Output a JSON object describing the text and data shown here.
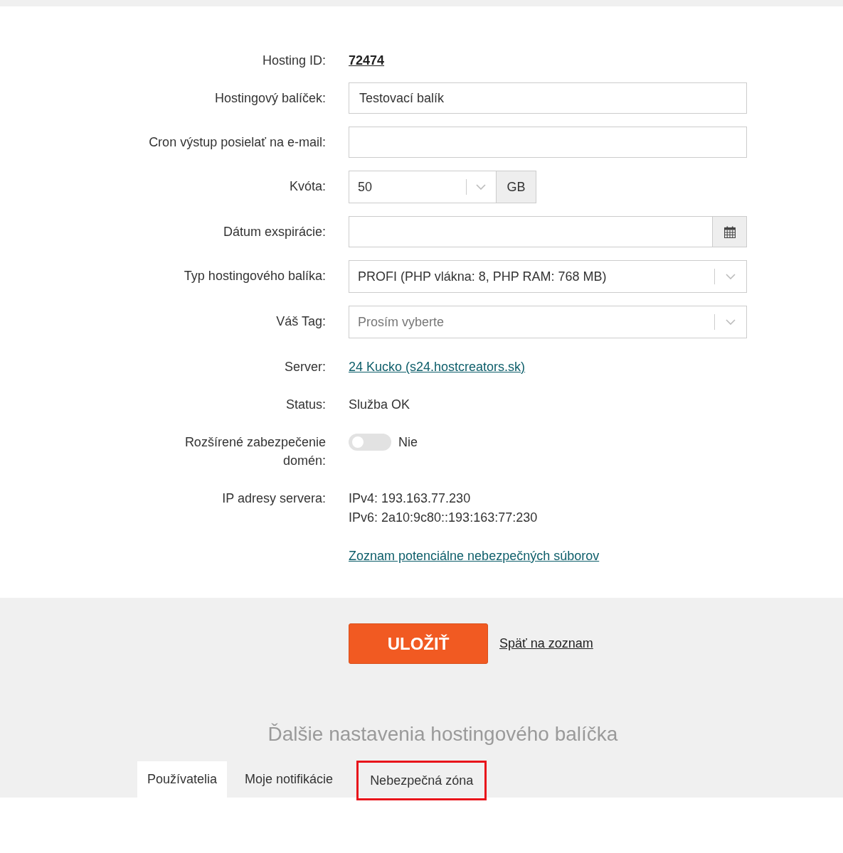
{
  "form": {
    "rows": [
      {
        "kind": "id_link",
        "label": "Hosting ID:",
        "value": "72474"
      },
      {
        "kind": "text_input",
        "label": "Hostingový balíček:",
        "value": "Testovací balík"
      },
      {
        "kind": "text_input",
        "label": "Cron výstup posielať na e-mail:"
      },
      {
        "kind": "quota",
        "label": "Kvóta:",
        "value": "50",
        "unit": "GB"
      },
      {
        "kind": "date_input",
        "label": "Dátum exspirácie:"
      },
      {
        "kind": "select",
        "label": "Typ hostingového balíka:",
        "value": "PROFI (PHP vlákna: 8, PHP RAM: 768 MB)"
      },
      {
        "kind": "select",
        "label": "Váš Tag:",
        "placeholder": "Prosím vyberte"
      },
      {
        "kind": "link",
        "label": "Server:",
        "value": "24 Kucko (s24.hostcreators.sk)"
      },
      {
        "kind": "text",
        "label": "Status:",
        "value": "Služba OK"
      },
      {
        "kind": "toggle",
        "label": "Rozšírené zabezpečenie domén:",
        "on": false,
        "value": "Nie"
      },
      {
        "kind": "lines",
        "label": "IP adresy servera:",
        "lines": [
          "IPv4: 193.163.77.230",
          "IPv6: 2a10:9c80::193:163:77:230"
        ]
      },
      {
        "kind": "link",
        "value": "Zoznam potenciálne nebezpečných súborov"
      }
    ]
  },
  "actions": {
    "save_button": "ULOŽIŤ",
    "back_link": "Späť na zoznam"
  },
  "more_settings": {
    "heading": "Ďalšie nastavenia hostingového balíčka",
    "tabs": [
      {
        "label": "Používatelia",
        "selected": true,
        "highlighted": false
      },
      {
        "label": "Moje notifikácie",
        "selected": false,
        "highlighted": false
      },
      {
        "label": "Nebezpečná zóna",
        "selected": false,
        "highlighted": true
      }
    ]
  }
}
